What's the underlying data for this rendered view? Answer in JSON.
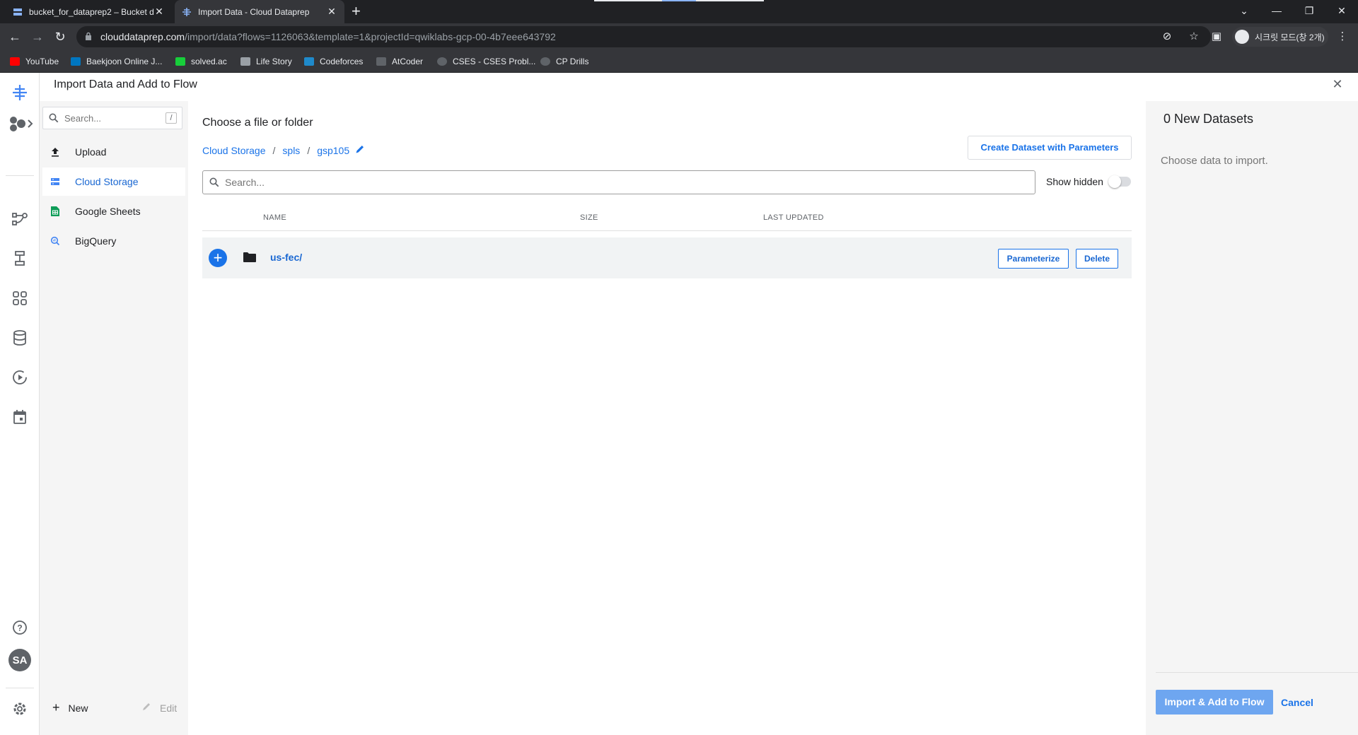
{
  "browser": {
    "tabs": [
      {
        "title": "bucket_for_dataprep2 – Bucket d"
      },
      {
        "title": "Import Data - Cloud Dataprep"
      }
    ],
    "new_tab": "+",
    "url_host": "clouddataprep.com",
    "url_path": "/import/data?flows=1126063&template=1&projectId=qwiklabs-gcp-00-4b7eee643792",
    "profile_label": "시크릿 모드(창 2개)",
    "bookmarks": [
      "YouTube",
      "Baekjoon Online J...",
      "solved.ac",
      "Life Story",
      "Codeforces",
      "AtCoder",
      "CSES - CSES Probl...",
      "CP Drills"
    ]
  },
  "rail": {
    "avatar_initials": "SA"
  },
  "dialog": {
    "title": "Import Data and Add to Flow"
  },
  "left_panel": {
    "search_placeholder": "Search...",
    "search_shortcut": "/",
    "items": [
      {
        "label": "Upload",
        "icon": "upload-icon"
      },
      {
        "label": "Cloud Storage",
        "icon": "storage-icon",
        "active": true
      },
      {
        "label": "Google Sheets",
        "icon": "sheets-icon"
      },
      {
        "label": "BigQuery",
        "icon": "bigquery-icon"
      }
    ],
    "new_label": "New",
    "edit_label": "Edit"
  },
  "main": {
    "heading": "Choose a file or folder",
    "breadcrumb": [
      "Cloud Storage",
      "spls",
      "gsp105"
    ],
    "create_params_button": "Create Dataset with Parameters",
    "search_placeholder": "Search...",
    "show_hidden_label": "Show hidden",
    "columns": {
      "name": "NAME",
      "size": "SIZE",
      "last_updated": "LAST UPDATED"
    },
    "rows": [
      {
        "name": "us-fec/",
        "size": "",
        "last_updated": "",
        "parameterize": "Parameterize",
        "delete": "Delete"
      }
    ]
  },
  "right_panel": {
    "title": "0 New Datasets",
    "subtitle": "Choose data to import.",
    "import_button": "Import & Add to Flow",
    "cancel_button": "Cancel"
  },
  "colors": {
    "accent": "#1a73e8",
    "import_button": "#6ea6f0",
    "panel_bg": "#f5f5f5",
    "chrome_dark": "#202124"
  }
}
